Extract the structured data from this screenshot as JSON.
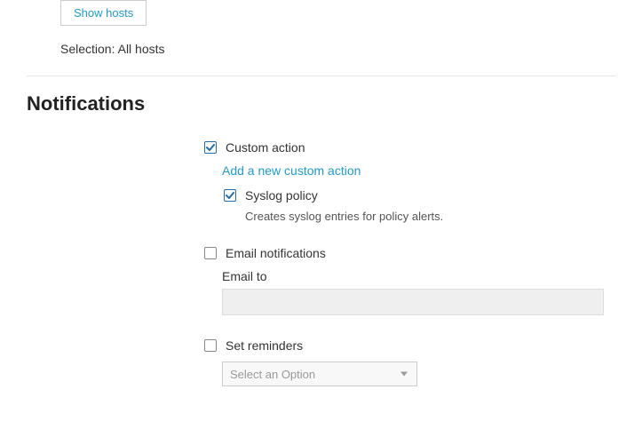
{
  "hosts": {
    "show_button_label": "Show hosts",
    "selection_label": "Selection:",
    "selection_value": "All hosts"
  },
  "notifications": {
    "section_title": "Notifications",
    "custom_action": {
      "label": "Custom action",
      "checked": true,
      "add_link": "Add a new custom action",
      "syslog": {
        "label": "Syslog policy",
        "checked": true,
        "description": "Creates syslog entries for policy alerts."
      }
    },
    "email": {
      "label": "Email notifications",
      "checked": false,
      "field_label": "Email to",
      "value": ""
    },
    "reminders": {
      "label": "Set reminders",
      "checked": false,
      "select_placeholder": "Select an Option"
    }
  }
}
